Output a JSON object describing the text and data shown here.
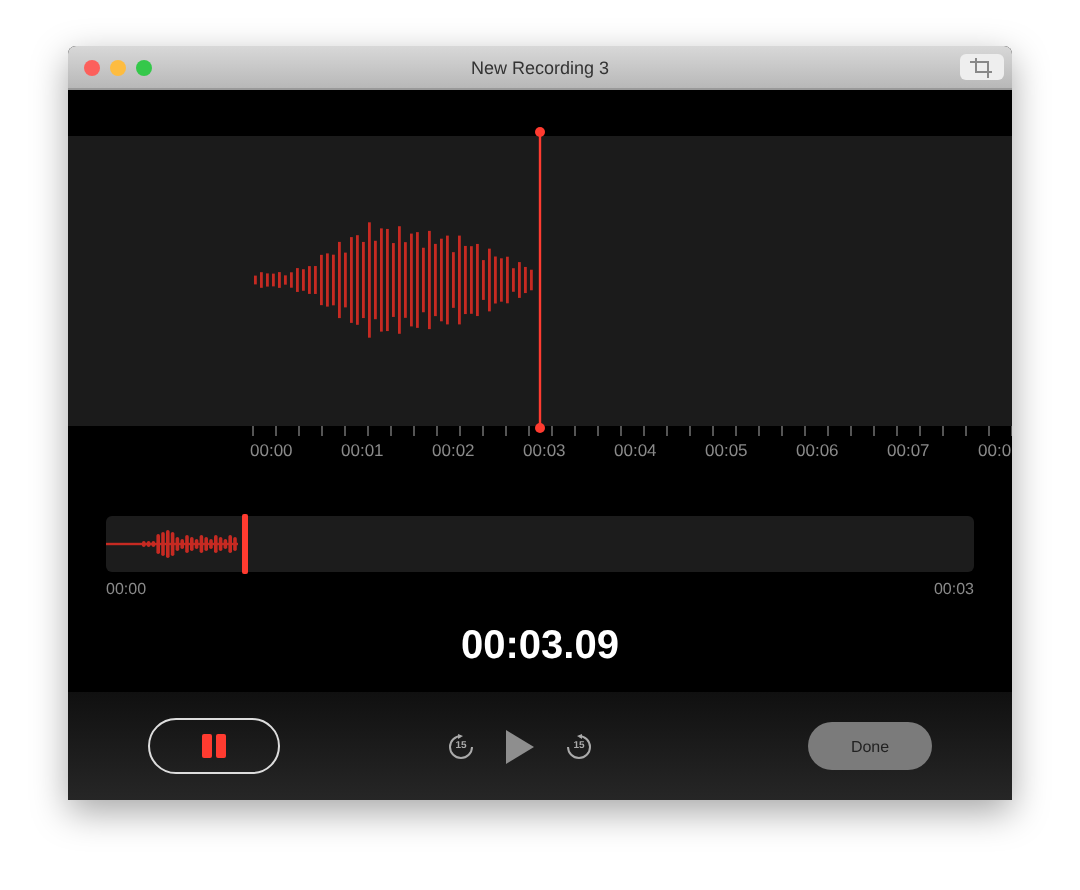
{
  "window": {
    "title": "New Recording 3"
  },
  "ruler": {
    "labels": [
      "00:00",
      "00:01",
      "00:02",
      "00:03",
      "00:04",
      "00:05",
      "00:06",
      "00:07",
      "00:0"
    ]
  },
  "overview": {
    "level": 0.157,
    "start": "00:00",
    "end": "00:03"
  },
  "elapsed": "00:03.09",
  "controls": {
    "skip_back": "15",
    "skip_forward": "15",
    "done": "Done"
  }
}
